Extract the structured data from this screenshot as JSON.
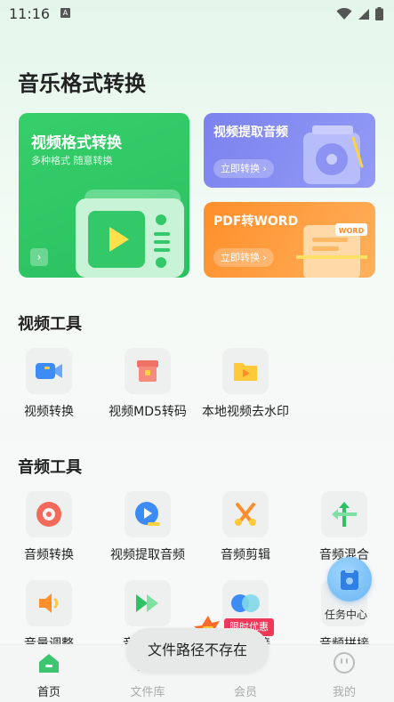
{
  "status_bar": {
    "time": "11:16",
    "notif": "A"
  },
  "page": {
    "title": "音乐格式转换"
  },
  "cards": {
    "video_convert": {
      "title": "视频格式转换",
      "subtitle": "多种格式 随意转换",
      "arrow": "›"
    },
    "extract_audio": {
      "title": "视频提取音频",
      "button": "立即转换 ›"
    },
    "pdf_word": {
      "title": "PDF转WORD",
      "button": "立即转换 ›",
      "badge": "WORD"
    }
  },
  "sections": {
    "video_tools": {
      "title": "视频工具",
      "items": [
        {
          "label": "视频转换",
          "icon": "video-camera-icon"
        },
        {
          "label": "视频MD5转码",
          "icon": "archive-box-icon"
        },
        {
          "label": "本地视频去水印",
          "icon": "folder-play-icon"
        }
      ]
    },
    "audio_tools": {
      "title": "音频工具",
      "items": [
        {
          "label": "音频转换",
          "icon": "music-disc-icon"
        },
        {
          "label": "视频提取音频",
          "icon": "play-extract-icon"
        },
        {
          "label": "音频剪辑",
          "icon": "scissors-icon"
        },
        {
          "label": "音频混合",
          "icon": "merge-arrows-icon"
        },
        {
          "label": "音量调整",
          "icon": "speaker-icon"
        },
        {
          "label": "音频变速",
          "icon": "fast-forward-icon"
        },
        {
          "label": "音频拼接",
          "icon": "join-circles-icon"
        },
        {
          "label": "音频拼接",
          "icon": "placeholder-icon"
        }
      ]
    }
  },
  "float_button": {
    "label": "任务中心"
  },
  "promo": {
    "text": "限时优惠"
  },
  "toast": {
    "text": "文件路径不存在"
  },
  "bottom_nav": {
    "items": [
      {
        "label": "首页",
        "active": true
      },
      {
        "label": "文件库",
        "active": false
      },
      {
        "label": "会员",
        "active": false
      },
      {
        "label": "我的",
        "active": false
      }
    ]
  },
  "colors": {
    "accent": "#2ec265",
    "purple": "#7b82ee",
    "orange": "#ff8f2a",
    "nav_active": "#3ec56f"
  }
}
